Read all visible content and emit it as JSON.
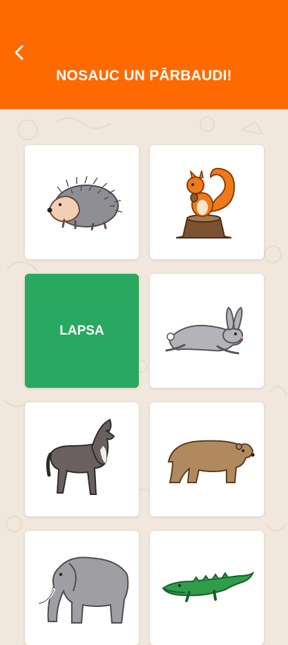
{
  "header": {
    "title": "NOSAUC UN PĀRBAUDI!",
    "back_icon": "chevron-left-icon",
    "background": "#ff6a00"
  },
  "cards": [
    {
      "type": "image",
      "animal": "hedgehog"
    },
    {
      "type": "image",
      "animal": "squirrel"
    },
    {
      "type": "word",
      "label": "LAPSA",
      "color": "#28a860"
    },
    {
      "type": "image",
      "animal": "hare"
    },
    {
      "type": "image",
      "animal": "wolf"
    },
    {
      "type": "image",
      "animal": "bear"
    },
    {
      "type": "image",
      "animal": "elephant"
    },
    {
      "type": "image",
      "animal": "crocodile"
    }
  ]
}
